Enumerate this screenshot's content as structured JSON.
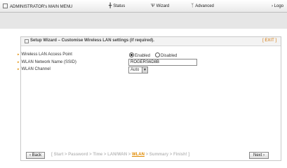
{
  "topbar": {
    "menu": "ADMINISTRATOR's MAIN MENU",
    "status": "Status",
    "wizard": "Wizard",
    "advanced": "Advanced",
    "logout": "› Logo"
  },
  "panel": {
    "title": "Setup Wizard – Customise Wireless LAN settings (if required).",
    "exit": "[ EXIT ]"
  },
  "fields": {
    "access_point_label": "Wireless LAN Access Point",
    "enabled": "Enabled",
    "disabled": "Disabled",
    "ssid_label": "WLAN Network Name (SSID)",
    "ssid_value": "ROGERS6D8B",
    "channel_label": "WLAN Channel",
    "channel_value": "Auto"
  },
  "nav": {
    "back": "‹ Back",
    "next": "Next ›",
    "steps_before": "[ Start > Password > Time > LAN/WAN > ",
    "steps_current": "WLAN",
    "steps_after": " > Summary > Finish! ]"
  }
}
